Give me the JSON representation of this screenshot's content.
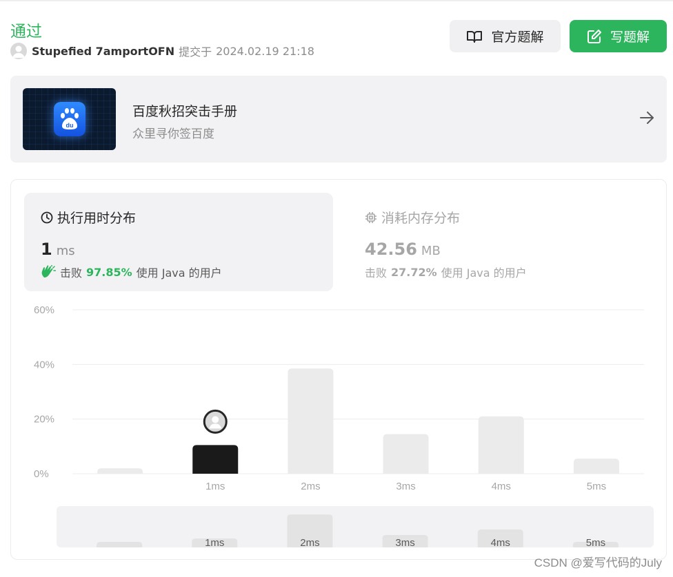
{
  "submission": {
    "status": "通过",
    "user": "Stupefied 7amportOFN",
    "verb": "提交于",
    "timestamp": "2024.02.19 21:18"
  },
  "buttons": {
    "official": "官方题解",
    "write": "写题解"
  },
  "banner": {
    "title": "百度秋招突击手册",
    "subtitle": "众里寻你签百度"
  },
  "runtime": {
    "title": "执行用时分布",
    "value": "1",
    "unit": "ms",
    "beats_label": "击败",
    "beats_pct": "97.85%",
    "beats_suffix": "使用 Java 的用户"
  },
  "memory": {
    "title": "消耗内存分布",
    "value": "42.56",
    "unit": "MB",
    "beats_label": "击败",
    "beats_pct": "27.72%",
    "beats_suffix": "使用 Java 的用户"
  },
  "chart_data": {
    "type": "bar",
    "categories": [
      "",
      "1ms",
      "2ms",
      "3ms",
      "4ms",
      "5ms"
    ],
    "values": [
      2,
      10.5,
      38.5,
      14.5,
      21,
      5.5
    ],
    "highlight_index": 1,
    "ylim": [
      0,
      60
    ],
    "yticks": [
      "0%",
      "20%",
      "40%",
      "60%"
    ],
    "grid": true,
    "colors": {
      "bar": "#ebebeb",
      "highlight": "#1a1a1a",
      "grid": "#ececec"
    },
    "minimap": {
      "categories": [
        "",
        "1ms",
        "2ms",
        "3ms",
        "4ms",
        "5ms"
      ],
      "values": [
        2,
        10.5,
        38.5,
        14.5,
        21,
        5.5
      ]
    }
  },
  "watermark": "CSDN @爱写代码的July"
}
